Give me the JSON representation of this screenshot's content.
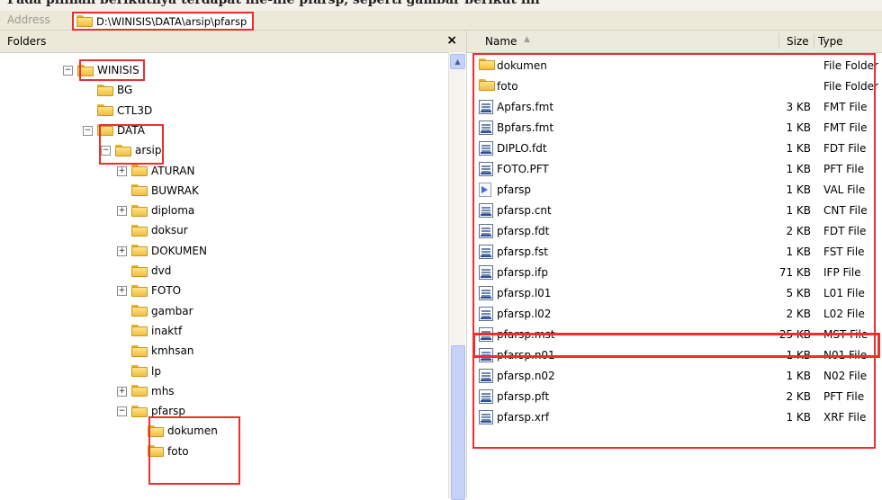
{
  "caption": "Pada pilihan berikutnya terdapat file-file pfarsp, seperti gambar berikut ini",
  "address": {
    "label": "Address",
    "path": "D:\\WINISIS\\DATA\\arsip\\pfarsp"
  },
  "folders_pane": {
    "title": "Folders",
    "close": "×",
    "tree": [
      {
        "label": "WINISIS",
        "expander": "minus"
      },
      {
        "label": "BG",
        "expander": ""
      },
      {
        "label": "CTL3D",
        "expander": ""
      },
      {
        "label": "DATA",
        "expander": "minus"
      },
      {
        "label": "arsip",
        "expander": "minus"
      },
      {
        "label": "ATURAN",
        "expander": "plus"
      },
      {
        "label": "BUWRAK",
        "expander": ""
      },
      {
        "label": "diploma",
        "expander": "plus"
      },
      {
        "label": "doksur",
        "expander": ""
      },
      {
        "label": "DOKUMEN",
        "expander": "plus"
      },
      {
        "label": "dvd",
        "expander": ""
      },
      {
        "label": "FOTO",
        "expander": "plus"
      },
      {
        "label": "gambar",
        "expander": ""
      },
      {
        "label": "inaktf",
        "expander": ""
      },
      {
        "label": "kmhsan",
        "expander": ""
      },
      {
        "label": "lp",
        "expander": ""
      },
      {
        "label": "mhs",
        "expander": "plus"
      },
      {
        "label": "pfarsp",
        "expander": "minus"
      },
      {
        "label": "dokumen",
        "expander": ""
      },
      {
        "label": "foto",
        "expander": ""
      }
    ]
  },
  "files_pane": {
    "columns": {
      "name": "Name",
      "sort_indicator": "▲",
      "size": "Size",
      "type": "Type"
    },
    "files": [
      {
        "name": "dokumen",
        "size": "",
        "type": "File Folder",
        "icon": "folder-icon"
      },
      {
        "name": "foto",
        "size": "",
        "type": "File Folder",
        "icon": "folder-icon"
      },
      {
        "name": "Apfars.fmt",
        "size": "3 KB",
        "type": "FMT File",
        "icon": "document-icon"
      },
      {
        "name": "Bpfars.fmt",
        "size": "1 KB",
        "type": "FMT File",
        "icon": "document-icon"
      },
      {
        "name": "DIPLO.fdt",
        "size": "1 KB",
        "type": "FDT File",
        "icon": "document-icon"
      },
      {
        "name": "FOTO.PFT",
        "size": "1 KB",
        "type": "PFT File",
        "icon": "document-icon"
      },
      {
        "name": "pfarsp",
        "size": "1 KB",
        "type": "VAL File",
        "icon": "val-file-icon"
      },
      {
        "name": "pfarsp.cnt",
        "size": "1 KB",
        "type": "CNT File",
        "icon": "document-icon"
      },
      {
        "name": "pfarsp.fdt",
        "size": "2 KB",
        "type": "FDT File",
        "icon": "document-icon"
      },
      {
        "name": "pfarsp.fst",
        "size": "1 KB",
        "type": "FST File",
        "icon": "document-icon"
      },
      {
        "name": "pfarsp.ifp",
        "size": "71 KB",
        "type": "IFP File",
        "icon": "document-icon"
      },
      {
        "name": "pfarsp.l01",
        "size": "5 KB",
        "type": "L01 File",
        "icon": "document-icon"
      },
      {
        "name": "pfarsp.l02",
        "size": "2 KB",
        "type": "L02 File",
        "icon": "document-icon"
      },
      {
        "name": "pfarsp.mst",
        "size": "25 KB",
        "type": "MST File",
        "icon": "document-icon"
      },
      {
        "name": "pfarsp.n01",
        "size": "1 KB",
        "type": "N01 File",
        "icon": "document-icon"
      },
      {
        "name": "pfarsp.n02",
        "size": "1 KB",
        "type": "N02 File",
        "icon": "document-icon"
      },
      {
        "name": "pfarsp.pft",
        "size": "2 KB",
        "type": "PFT File",
        "icon": "document-icon"
      },
      {
        "name": "pfarsp.xrf",
        "size": "1 KB",
        "type": "XRF File",
        "icon": "document-icon"
      }
    ]
  },
  "colors": {
    "highlight_border": "#ef2d2d",
    "folder": "#f1bf3d",
    "toolbar": "#ece9d8"
  }
}
